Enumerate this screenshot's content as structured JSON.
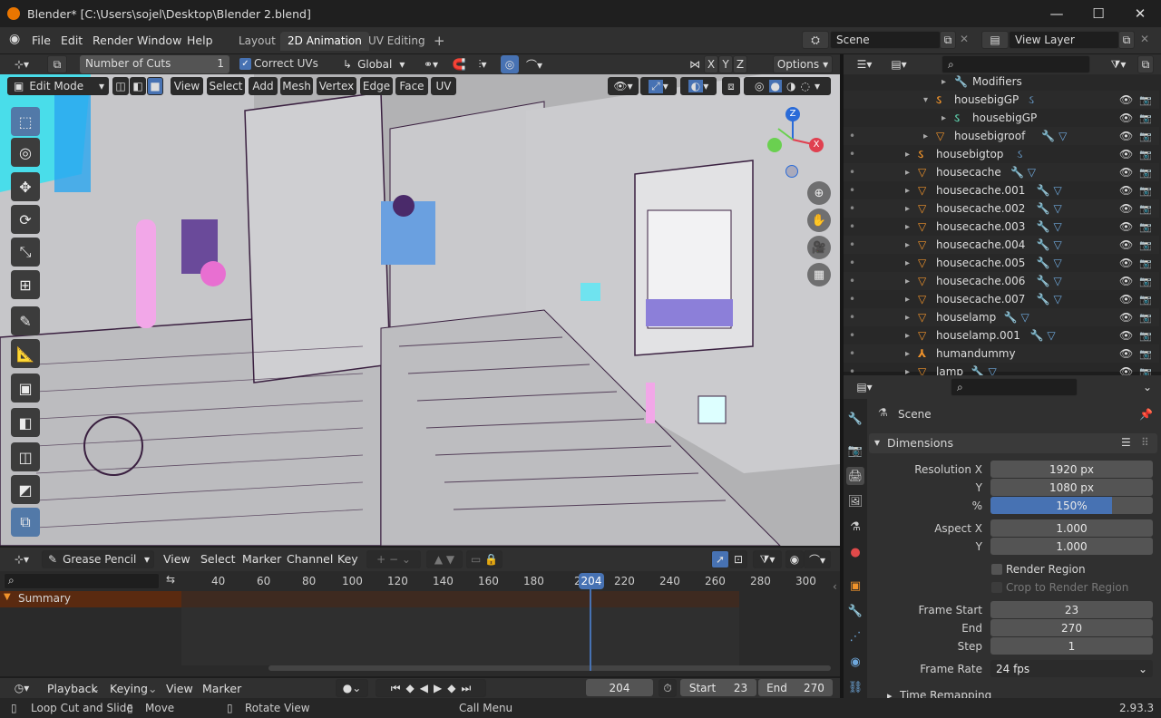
{
  "title_bar": {
    "title": "Blender* [C:\\Users\\sojel\\Desktop\\Blender 2.blend]",
    "minimize": "—",
    "maximize": "☐",
    "close": "✕"
  },
  "menu": {
    "items": [
      "File",
      "Edit",
      "Render",
      "Window",
      "Help"
    ],
    "workspaces": [
      "Layout",
      "2D Animation",
      "UV Editing"
    ],
    "active_workspace": "2D Animation",
    "add_workspace": "+",
    "scene_name": "Scene",
    "view_layer_name": "View Layer"
  },
  "tool_header": {
    "number_of_cuts_label": "Number of Cuts",
    "number_of_cuts_value": "1",
    "correct_uvs_label": "Correct UVs",
    "correct_uvs_checked": true,
    "orientation": "Global",
    "axes": [
      "X",
      "Y",
      "Z"
    ],
    "options": "Options"
  },
  "viewport_header": {
    "mode": "Edit Mode",
    "menus": [
      "View",
      "Select",
      "Add",
      "Mesh",
      "Vertex",
      "Edge",
      "Face",
      "UV"
    ]
  },
  "gizmo": {
    "x": "X",
    "y": "Y",
    "z": "Z"
  },
  "tools": [
    {
      "icon": "select-box-icon",
      "glyph": "⬚"
    },
    {
      "icon": "cursor-icon",
      "glyph": "◎"
    },
    {
      "icon": "move-icon",
      "glyph": "✥"
    },
    {
      "icon": "rotate-icon",
      "glyph": "⟳"
    },
    {
      "icon": "scale-icon",
      "glyph": "⤡"
    },
    {
      "icon": "transform-icon",
      "glyph": "⊞"
    },
    {
      "icon": "annotate-icon",
      "glyph": "✎"
    },
    {
      "icon": "measure-icon",
      "glyph": "📐"
    },
    {
      "icon": "add-cube-icon",
      "glyph": "▣"
    },
    {
      "icon": "extrude-icon",
      "glyph": "◧"
    },
    {
      "icon": "inset-icon",
      "glyph": "◫"
    },
    {
      "icon": "bevel-icon",
      "glyph": "◩"
    },
    {
      "icon": "loop-cut-icon",
      "glyph": "⧉"
    }
  ],
  "outliner": {
    "rows": [
      {
        "name": "Modifiers",
        "indent": 3,
        "icon": "wrench",
        "color": "#6fa8dc"
      },
      {
        "name": "housebigGP",
        "indent": 2,
        "icon": "gp",
        "color": "#f0932b"
      },
      {
        "name": "housebigGP",
        "indent": 3,
        "icon": "gpdata",
        "color": "#5cc9a7"
      },
      {
        "name": "housebigroof",
        "indent": 2,
        "icon": "mesh",
        "color": "#f0932b"
      },
      {
        "name": "housebigtop",
        "indent": 1,
        "icon": "gp",
        "color": "#f0932b"
      },
      {
        "name": "housecache",
        "indent": 1,
        "icon": "mesh",
        "color": "#f0932b"
      },
      {
        "name": "housecache.001",
        "indent": 1,
        "icon": "mesh",
        "color": "#f0932b"
      },
      {
        "name": "housecache.002",
        "indent": 1,
        "icon": "mesh",
        "color": "#f0932b"
      },
      {
        "name": "housecache.003",
        "indent": 1,
        "icon": "mesh",
        "color": "#f0932b"
      },
      {
        "name": "housecache.004",
        "indent": 1,
        "icon": "mesh",
        "color": "#f0932b"
      },
      {
        "name": "housecache.005",
        "indent": 1,
        "icon": "mesh",
        "color": "#f0932b"
      },
      {
        "name": "housecache.006",
        "indent": 1,
        "icon": "mesh",
        "color": "#f0932b"
      },
      {
        "name": "housecache.007",
        "indent": 1,
        "icon": "mesh",
        "color": "#f0932b"
      },
      {
        "name": "houselamp",
        "indent": 1,
        "icon": "mesh",
        "color": "#f0932b"
      },
      {
        "name": "houselamp.001",
        "indent": 1,
        "icon": "mesh",
        "color": "#f0932b"
      },
      {
        "name": "humandummy",
        "indent": 1,
        "icon": "armature",
        "color": "#f0932b"
      },
      {
        "name": "lamp",
        "indent": 1,
        "icon": "mesh",
        "color": "#f0932b"
      }
    ]
  },
  "properties": {
    "context": "Scene",
    "panel": "Dimensions",
    "resolution_x_label": "Resolution X",
    "resolution_x": "1920 px",
    "resolution_y_label": "Y",
    "resolution_y": "1080 px",
    "percent_label": "%",
    "percent": "150%",
    "percent_fill": 0.75,
    "aspect_x_label": "Aspect X",
    "aspect_x": "1.000",
    "aspect_y_label": "Y",
    "aspect_y": "1.000",
    "render_region": "Render Region",
    "crop_region": "Crop to Render Region",
    "frame_start_label": "Frame Start",
    "frame_start": "23",
    "end_label": "End",
    "end": "270",
    "step_label": "Step",
    "step": "1",
    "frame_rate_label": "Frame Rate",
    "frame_rate": "24 fps",
    "time_remapping": "Time Remapping"
  },
  "dopesheet": {
    "mode": "Grease Pencil",
    "menus": [
      "View",
      "Select",
      "Marker",
      "Channel",
      "Key"
    ],
    "summary": "Summary",
    "current_frame": "204",
    "ticks": [
      "40",
      "60",
      "80",
      "100",
      "120",
      "140",
      "160",
      "180",
      "2",
      "220",
      "240",
      "260",
      "280",
      "300"
    ]
  },
  "timeline": {
    "menus": [
      "Playback",
      "Keying",
      "View",
      "Marker"
    ],
    "frame": "204",
    "start_label": "Start",
    "start": "23",
    "end_label": "End",
    "end": "270"
  },
  "status_bar": {
    "loop_cut": "Loop Cut and Slide",
    "move": "Move",
    "rotate": "Rotate View",
    "call_menu": "Call Menu",
    "version": "2.93.3"
  }
}
